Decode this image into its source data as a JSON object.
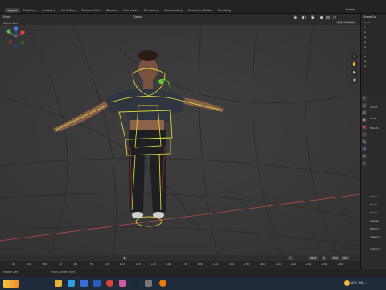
{
  "menubar": {
    "workspaces": [
      "Layout",
      "Modeling",
      "Sculpting",
      "UV Editing",
      "Texture Paint",
      "Shading",
      "Animation",
      "Rendering",
      "Compositing",
      "Geometry Nodes",
      "Scripting"
    ],
    "active_workspace": "Layout",
    "scene": "Scene"
  },
  "viewport_header": {
    "mode": "Pose",
    "select": "Select Box",
    "orientation": "Global",
    "pose_options": "Pose Options"
  },
  "outliner": {
    "title": "Scene Co",
    "rows": [
      "Colle",
      "C",
      "A",
      "A",
      "A",
      "A",
      "A",
      "A",
      "A",
      "A"
    ]
  },
  "properties": {
    "rows": [
      "Armat",
      "Bone",
      "Transfo",
      "Rotatio",
      "Bendy",
      "Relatio",
      "Inverse",
      "Deform",
      "Viewport",
      "Custom"
    ]
  },
  "timeline": {
    "ticks": [
      40,
      50,
      60,
      70,
      80,
      90,
      100,
      110,
      120,
      130,
      140,
      150,
      160,
      170,
      180,
      190,
      200,
      210,
      220,
      230,
      240,
      250
    ],
    "current_frame": "1",
    "start_label": "Start",
    "start": "1",
    "end_label": "End",
    "end": "250"
  },
  "statusbar": {
    "left": "Rotate View",
    "middle": "Pose Context Menu"
  },
  "taskbar": {
    "weather": "10°C  Trời ...",
    "icons": [
      "file-explorer",
      "edge",
      "mail",
      "word",
      "chrome",
      "steam",
      "vscode",
      "photos",
      "blender"
    ]
  },
  "colors": {
    "armature_yellow": "#d8d23a",
    "active_bone_green": "#5fcf3f",
    "grid_red_axis": "#b24a4a"
  }
}
